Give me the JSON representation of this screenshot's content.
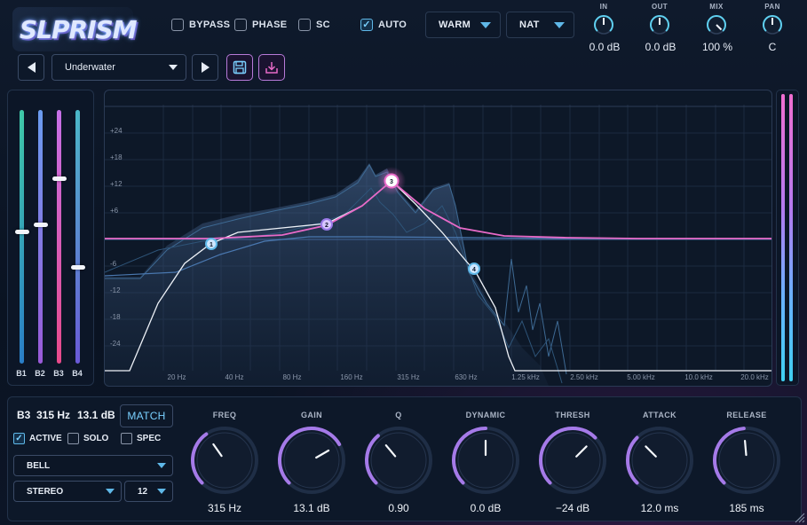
{
  "header": {
    "logo_text": "SLPRISM",
    "checkboxes": [
      {
        "label": "BYPASS",
        "checked": false
      },
      {
        "label": "PHASE",
        "checked": false
      },
      {
        "label": "SC",
        "checked": false
      },
      {
        "label": "AUTO",
        "checked": true
      }
    ],
    "mode_dropdowns": [
      {
        "value": "WARM"
      },
      {
        "value": "NAT"
      }
    ],
    "meters": [
      {
        "label": "IN",
        "value": "0.0 dB"
      },
      {
        "label": "OUT",
        "value": "0.0 dB"
      },
      {
        "label": "MIX",
        "value": "100 %"
      },
      {
        "label": "PAN",
        "value": "C"
      }
    ]
  },
  "preset": {
    "name": "Underwater",
    "prev_icon": "arrow-left-icon",
    "next_icon": "arrow-right-icon",
    "save_icon": "save-icon",
    "load_icon": "download-icon"
  },
  "bands": [
    {
      "label": "B1",
      "level": 0.52,
      "color_top": "#3fc8a8",
      "color_bottom": "#2a7ec8"
    },
    {
      "label": "B2",
      "level": 0.55,
      "color_top": "#6a9cf0",
      "color_bottom": "#9a5ad8"
    },
    {
      "label": "B3",
      "level": 0.73,
      "color_top": "#c670e8",
      "color_bottom": "#e84a8a"
    },
    {
      "label": "B4",
      "level": 0.38,
      "color_top": "#4ab8c8",
      "color_bottom": "#6a5ad8"
    }
  ],
  "graph": {
    "y_ticks": [
      "+24",
      "+18",
      "+12",
      "+6",
      "-6",
      "-12",
      "-18",
      "-24"
    ],
    "x_ticks": [
      "20 Hz",
      "40 Hz",
      "80 Hz",
      "160 Hz",
      "315 Hz",
      "630 Hz",
      "1.25 kHz",
      "2.50 kHz",
      "5.00 kHz",
      "10.0 kHz",
      "20.0 kHz"
    ],
    "nodes": [
      "1",
      "2",
      "3",
      "4"
    ]
  },
  "selected_band": {
    "band": "B3",
    "freq": "315 Hz",
    "gain": "13.1 dB",
    "match_label": "MATCH",
    "options": [
      {
        "label": "ACTIVE",
        "checked": true
      },
      {
        "label": "SOLO",
        "checked": false
      },
      {
        "label": "SPEC",
        "checked": false
      }
    ],
    "filter_type": "BELL",
    "channel_mode": "STEREO",
    "slope": "12"
  },
  "knobs": [
    {
      "label": "FREQ",
      "value": "315 Hz"
    },
    {
      "label": "GAIN",
      "value": "13.1 dB"
    },
    {
      "label": "Q",
      "value": "0.90"
    },
    {
      "label": "DYNAMIC",
      "value": "0.0 dB"
    },
    {
      "label": "THRESH",
      "value": "−24 dB"
    },
    {
      "label": "ATTACK",
      "value": "12.0 ms"
    },
    {
      "label": "RELEASE",
      "value": "185 ms"
    }
  ],
  "colors": {
    "accent_cyan": "#5fb8e8",
    "accent_pink": "#e86ac8",
    "accent_purple": "#a57ae8",
    "background": "#0b1424"
  }
}
